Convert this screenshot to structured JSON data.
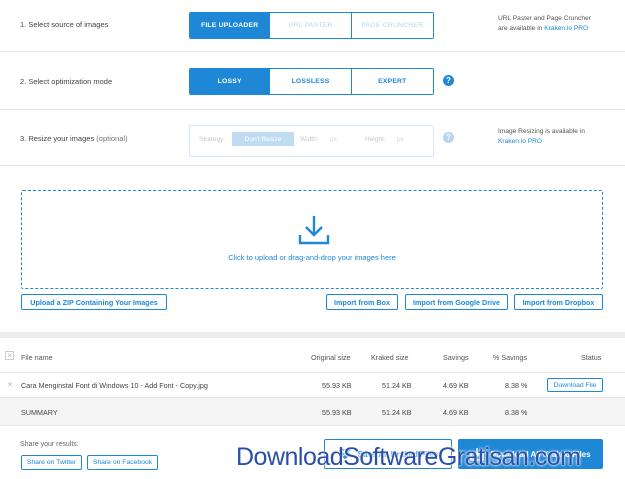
{
  "steps": {
    "source": {
      "label": "1. Select source of images",
      "options": [
        "FILE UPLOADER",
        "URL PASTER",
        "PAGE CRUNCHER"
      ],
      "note_line1": "URL Paster and Page Cruncher",
      "note_line2_prefix": "are available in ",
      "note_link": "Kraken.io PRO"
    },
    "mode": {
      "label": "2. Select optimization mode",
      "options": [
        "LOSSY",
        "LOSSLESS",
        "EXPERT"
      ]
    },
    "resize": {
      "label": "3. Resize your images",
      "label_optional": "(optional)",
      "strategy_label": "Strategy:",
      "strategy_value": "Don't Resize",
      "width_label": "Width:",
      "width_value": "px",
      "height_label": "Height:",
      "height_value": "px",
      "note_line1": "Image Resizing is available in",
      "note_link": "Kraken.io PRO"
    }
  },
  "dropzone": {
    "text": "Click to upload or drag-and-drop your images here"
  },
  "import_buttons": {
    "zip": "Upload a ZIP Containing Your Images",
    "box": "Import from Box",
    "drive": "Import from Google Drive",
    "dropbox": "Import from Dropbox"
  },
  "table": {
    "headers": {
      "file": "File name",
      "original": "Original size",
      "kraked": "Kraked size",
      "savings": "Savings",
      "pct": "% Savings",
      "status": "Status"
    },
    "rows": [
      {
        "file": "Cara Menginstal Font di Windows 10 - Add Font - Copy.jpg",
        "original": "55.93 KB",
        "kraked": "51.24 KB",
        "savings": "4.69 KB",
        "pct": "8.38 %",
        "action": "Download File"
      }
    ],
    "summary": {
      "label": "SUMMARY",
      "original": "55.93 KB",
      "kraked": "51.24 KB",
      "savings": "4.69 KB",
      "pct": "8.38 %"
    }
  },
  "share": {
    "label": "Share your results:",
    "twitter": "Share on Twitter",
    "facebook": "Share on Facebook"
  },
  "actions": {
    "save": "Save All Kraked Files",
    "download": "Download All Kraked Files"
  },
  "watermark": "DownloadSoftwareGratisan.com",
  "colors": {
    "accent": "#1e88d6",
    "separator": "#ececec"
  }
}
